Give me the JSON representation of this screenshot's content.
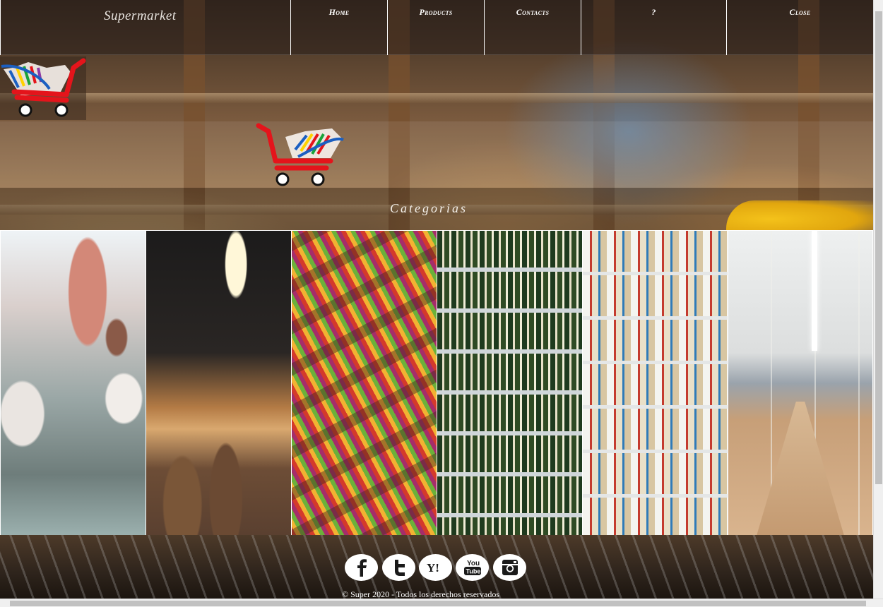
{
  "header": {
    "brand": "Supermarket",
    "nav": [
      {
        "label": "Home"
      },
      {
        "label": "Products"
      },
      {
        "label": "Contacts"
      },
      {
        "label": "?"
      },
      {
        "label": "Close"
      }
    ]
  },
  "section": {
    "title": "Categorias"
  },
  "categories": [
    {
      "icon": "butcher-counter-image"
    },
    {
      "icon": "bakery-image"
    },
    {
      "icon": "produce-aisle-image"
    },
    {
      "icon": "wine-shelf-image"
    },
    {
      "icon": "dairy-shelf-image"
    },
    {
      "icon": "store-aisle-image"
    }
  ],
  "footer": {
    "social": [
      {
        "icon": "facebook-icon"
      },
      {
        "icon": "twitter-icon"
      },
      {
        "icon": "yahoo-icon"
      },
      {
        "icon": "youtube-icon"
      },
      {
        "icon": "instagram-icon"
      }
    ],
    "copyright": "© Super 2020 - Todos los derechos reservados"
  },
  "colors": {
    "cart_red": "#e4141b",
    "header_overlay": "rgba(40,30,25,0.55)",
    "accent_yellow": "#f4c21a"
  }
}
